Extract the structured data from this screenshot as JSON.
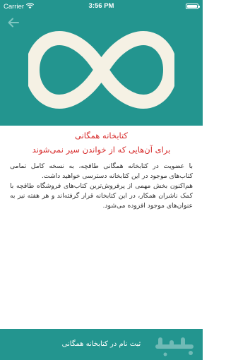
{
  "status_bar": {
    "carrier": "Carrier",
    "time": "3:56 PM",
    "wifi_icon": "wifi-icon",
    "battery_icon": "battery-icon"
  },
  "header": {
    "back_icon": "arrow-left-icon",
    "logo_icon": "infinity-icon"
  },
  "content": {
    "title": "کتابخانه همگانی",
    "subtitle": "برای آن‌هایی که از خواندن سیر نمی‌شوند",
    "paragraph_1": "با عضویت در کتابخانه همگانی طاقچه، به نسخه کامل تمامی کتاب‌های موجود در این کتابخانه دسترسی خواهید داشت.",
    "paragraph_2": "هم‌اکنون بخش مهمی از پرفروش‌ترین کتاب‌های فروشگاه طاقچه با کمک ناشران همکار، در این کتابخانه قرار گرفته‌اند و هر هفته نیز به عنوان‌های موجود افزوده می‌شود."
  },
  "footer": {
    "signup_label": "ثبت نام در کتابخانه همگانی"
  },
  "colors": {
    "primary": "#23958f",
    "accent_red": "#d62828",
    "logo": "#f5f1e4"
  }
}
